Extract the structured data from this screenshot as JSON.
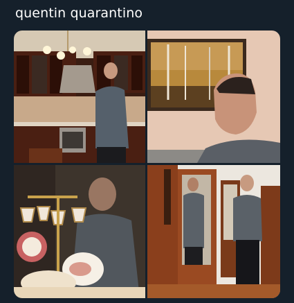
{
  "tweet": {
    "text": "quentin quarantino"
  },
  "media": {
    "photos": [
      {
        "name": "kitchen-photo"
      },
      {
        "name": "painting-photo"
      },
      {
        "name": "china-cabinet-photo"
      },
      {
        "name": "hallway-mirror-photo"
      }
    ]
  },
  "colors": {
    "background": "#15202b",
    "text": "#ffffff"
  }
}
